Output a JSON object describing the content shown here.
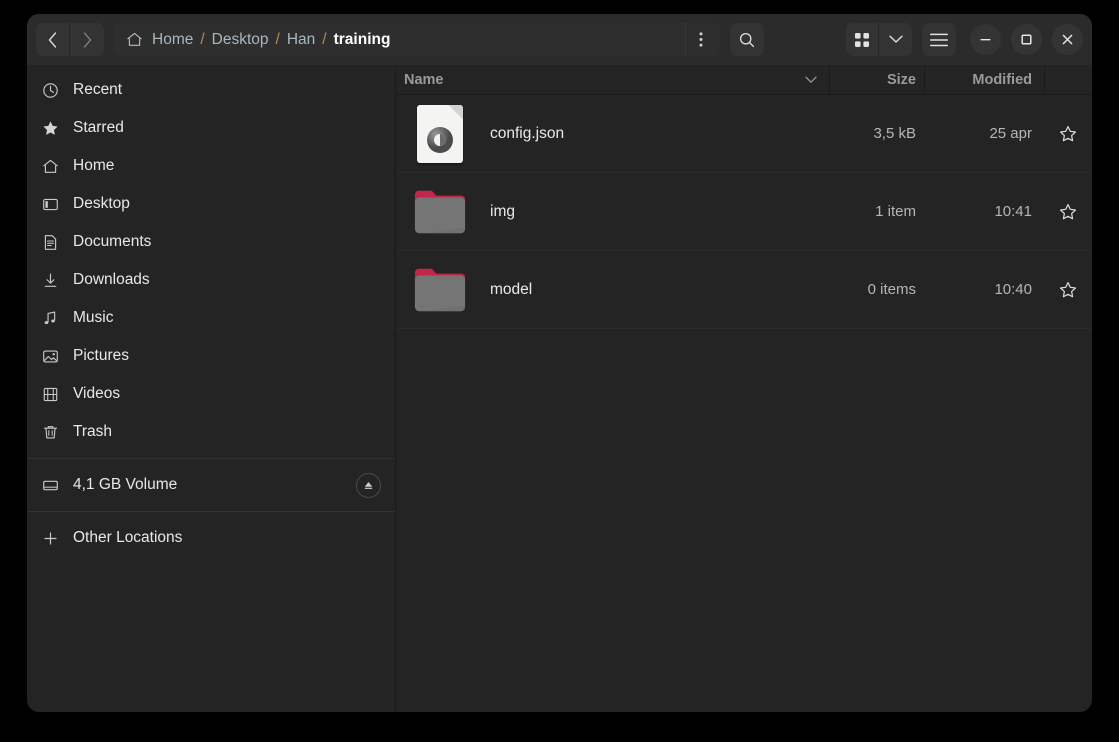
{
  "window": {
    "controls": {
      "minimize": "minimize-button",
      "maximize": "maximize-button",
      "close": "close-button"
    }
  },
  "header": {
    "back_tooltip": "Back",
    "forward_tooltip": "Forward",
    "path": {
      "home_icon": "home-icon",
      "segments": [
        {
          "label": "Home",
          "current": false
        },
        {
          "label": "Desktop",
          "current": false
        },
        {
          "label": "Han",
          "current": false
        },
        {
          "label": "training",
          "current": true
        }
      ],
      "separator": "/",
      "menu_icon": "kebab-menu-icon"
    },
    "search_icon": "search-icon",
    "grid_view_icon": "grid-view-icon",
    "view_chevron_icon": "chevron-down-icon",
    "hamburger_icon": "hamburger-menu-icon"
  },
  "sidebar": {
    "items": [
      {
        "label": "Recent",
        "icon": "clock-icon"
      },
      {
        "label": "Starred",
        "icon": "star-icon"
      },
      {
        "label": "Home",
        "icon": "home-icon"
      },
      {
        "label": "Desktop",
        "icon": "desktop-icon"
      },
      {
        "label": "Documents",
        "icon": "document-icon"
      },
      {
        "label": "Downloads",
        "icon": "download-icon"
      },
      {
        "label": "Music",
        "icon": "music-note-icon"
      },
      {
        "label": "Pictures",
        "icon": "picture-icon"
      },
      {
        "label": "Videos",
        "icon": "video-icon"
      },
      {
        "label": "Trash",
        "icon": "trash-icon"
      }
    ],
    "volume": {
      "label": "4,1 GB Volume",
      "icon": "drive-icon",
      "eject_icon": "eject-icon"
    },
    "other": {
      "label": "Other Locations",
      "icon": "plus-icon"
    }
  },
  "file_list": {
    "columns": {
      "name": "Name",
      "size": "Size",
      "modified": "Modified"
    },
    "sort_icon": "chevron-down-icon",
    "rows": [
      {
        "name": "config.json",
        "size": "3,5 kB",
        "modified": "25 apr",
        "type": "file",
        "star_icon": "star-outline-icon"
      },
      {
        "name": "img",
        "size": "1 item",
        "modified": "10:41",
        "type": "folder",
        "star_icon": "star-outline-icon"
      },
      {
        "name": "model",
        "size": "0 items",
        "modified": "10:40",
        "type": "folder",
        "star_icon": "star-outline-icon"
      }
    ]
  },
  "colors": {
    "window_bg": "#242424",
    "header_bg": "#2b2b2b",
    "folder_tab": "#c4264a",
    "folder_body": "#757575",
    "crumb_sep": "#c0884f",
    "crumb": "#a9b7c0"
  }
}
